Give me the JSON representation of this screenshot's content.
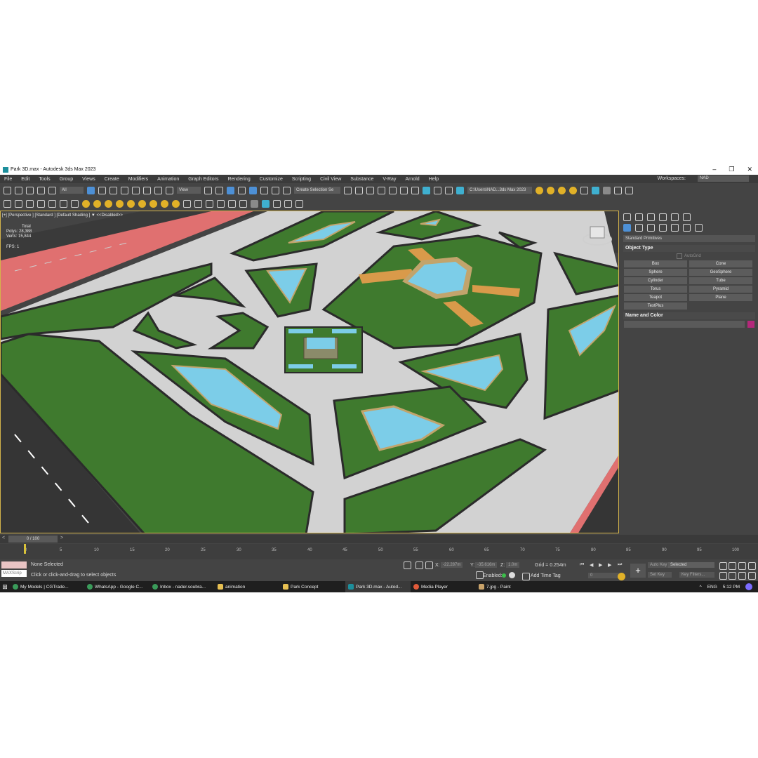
{
  "window": {
    "title": "Park 3D.max - Autodesk 3ds Max 2023",
    "minimize": "–",
    "maximize": "❐",
    "close": "✕"
  },
  "menu": [
    "File",
    "Edit",
    "Tools",
    "Group",
    "Views",
    "Create",
    "Modifiers",
    "Animation",
    "Graph Editors",
    "Rendering",
    "Customize",
    "Scripting",
    "Civil View",
    "Substance",
    "V-Ray",
    "Arnold",
    "Help"
  ],
  "workspace": {
    "label": "Workspaces:",
    "value": "NAD"
  },
  "toolbar": {
    "filter": "All",
    "refcoord": "View",
    "selection_set": "Create Selection Se",
    "project_path": "C:\\Users\\NAD...3ds Max 2023"
  },
  "viewport": {
    "label": "[+] [Perspective ] [Standard ] [Default Shading ]  ▼  <<Disabled>>",
    "stats_title": "Total",
    "polys": "Polys:  28,388",
    "verts": "Verts:  15,844",
    "fps": "FPS:     1"
  },
  "command_panel": {
    "category": "Standard Primitives",
    "object_type_header": "Object Type",
    "autogrid": "AutoGrid",
    "buttons": [
      "Box",
      "Cone",
      "Sphere",
      "GeoSphere",
      "Cylinder",
      "Tube",
      "Torus",
      "Pyramid",
      "Teapot",
      "Plane",
      "TextPlus"
    ],
    "name_color_header": "Name and Color",
    "swatch_color": "#b3287a"
  },
  "timeline": {
    "frame": "0 / 100",
    "ticks": [
      "0",
      "5",
      "10",
      "15",
      "20",
      "25",
      "30",
      "35",
      "40",
      "45",
      "50",
      "55",
      "60",
      "65",
      "70",
      "75",
      "80",
      "85",
      "90",
      "95",
      "100"
    ]
  },
  "status": {
    "maxscript": "MAXScrip",
    "selected": "None Selected",
    "prompt": "Click or click-and-drag to select objects",
    "x_label": "X:",
    "x": "-22.287m",
    "y_label": "Y:",
    "y": "-35.616m",
    "z_label": "Z:",
    "z": "1.0m",
    "grid": "Grid = 0.254m",
    "enabled": "Enabled:",
    "add_time_tag": "Add Time Tag",
    "auto_key": "Auto Key",
    "set_key": "Set Key",
    "key_mode": "Selected",
    "key_filters": "Key Filters...",
    "frame_field": "0"
  },
  "taskbar": {
    "items": [
      "My Models | CGTrade...",
      "WhatsApp - Google C...",
      "Inbox - nader.soubra...",
      "animation",
      "Park Concept",
      "Park 3D.max - Autod...",
      "Media Player",
      "7.jpg - Paint"
    ],
    "lang": "ENG",
    "time": "5:12 PM"
  },
  "colors": {
    "grass": "#3f7a2e",
    "water": "#7ccde8",
    "path": "#d2d2d2",
    "road": "#3a3a3a",
    "curb": "#e07070",
    "selection_border": "#d4b44a"
  }
}
